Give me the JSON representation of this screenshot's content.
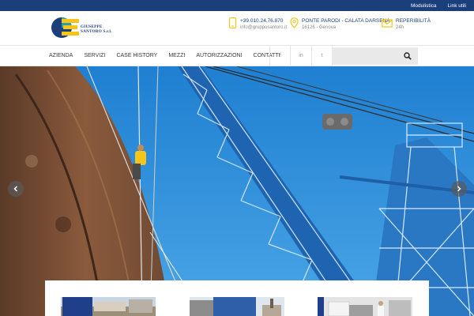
{
  "topbar": {
    "links": [
      "Modulistica",
      "Link utili"
    ]
  },
  "logo": {
    "line1": "GIUSEPPE",
    "line2": "SANTORO S.r.l."
  },
  "contacts": [
    {
      "icon": "phone-icon",
      "line1": "+39.010.24.76.870",
      "line2": "info@grupposantoro.it"
    },
    {
      "icon": "map-pin-icon",
      "line1": "PONTE PARODI - CALATA DARSENA",
      "line2": "16126 - Genova"
    },
    {
      "icon": "envelope-icon",
      "line1": "REPERIBILITÀ",
      "line2": "24h"
    }
  ],
  "nav": {
    "items": [
      "AZIENDA",
      "SERVIZI",
      "CASE HISTORY",
      "MEZZI",
      "AUTORIZZAZIONI",
      "CONTATTI"
    ]
  },
  "social": [
    "f",
    "in",
    "t"
  ],
  "search": {
    "placeholder": ""
  },
  "colors": {
    "brand": "#1b3f7a",
    "accent": "#f5c518",
    "sky": "#2f8fd8"
  }
}
